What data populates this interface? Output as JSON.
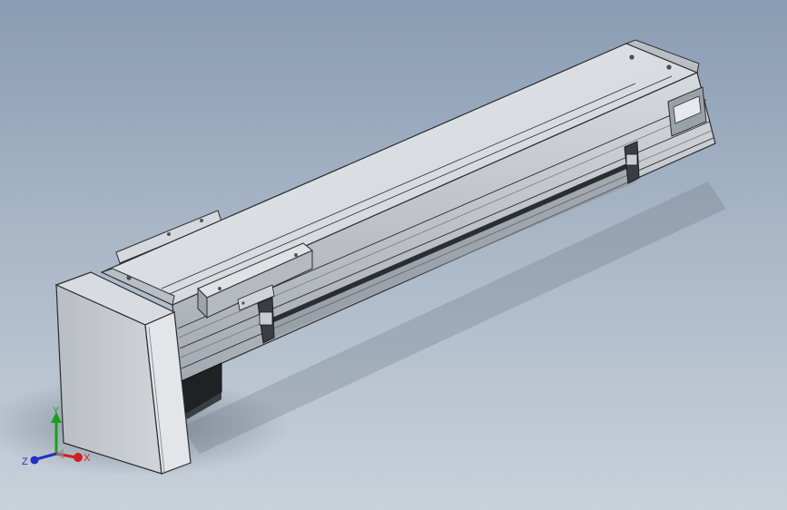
{
  "viewport": {
    "background_top": "#8a9cb3",
    "background_bottom": "#c9d1da"
  },
  "model": {
    "body_color": "#c8ccd1",
    "edge_color": "#2a2d30",
    "shadow_color": "#5f6b78"
  },
  "triad": {
    "x_label": "X",
    "y_label": "Y",
    "z_label": "Z",
    "x_color": "#d02020",
    "y_color": "#1aa01a",
    "z_color": "#2030c0"
  }
}
